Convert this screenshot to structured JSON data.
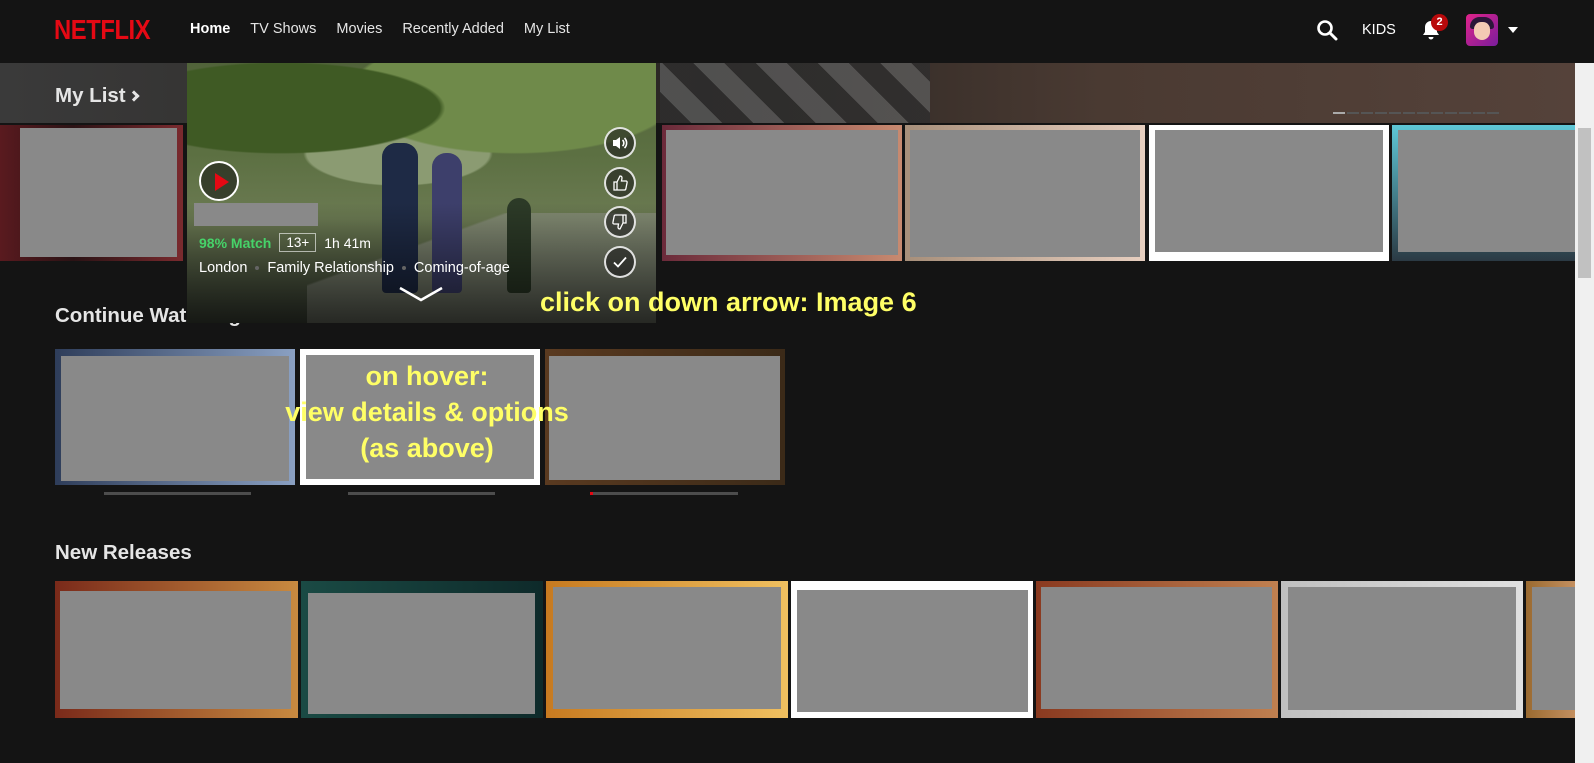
{
  "header": {
    "logo": "NETFLIX",
    "nav": [
      "Home",
      "TV Shows",
      "Movies",
      "Recently Added",
      "My List"
    ],
    "active_nav": "Home",
    "kids_label": "KIDS",
    "notification_count": "2"
  },
  "rows": {
    "my_list": {
      "title": "My List"
    },
    "continue_watching": {
      "title": "Continue Watching for Maria"
    },
    "new_releases": {
      "title": "New Releases"
    }
  },
  "hover_card": {
    "match": "98% Match",
    "rating": "13+",
    "runtime": "1h 41m",
    "tags": [
      "London",
      "Family Relationship",
      "Coming-of-age"
    ]
  },
  "annotations": {
    "down_arrow": "click on down arrow: Image 6",
    "hover_line1": "on hover:",
    "hover_line2": "view details & options",
    "hover_line3": "(as above)"
  },
  "continue_progress": [
    0.0,
    0.0,
    0.02
  ],
  "colors": {
    "brand": "#e50914",
    "match": "#46d369",
    "annotation": "#ffff66",
    "background": "#141414"
  }
}
